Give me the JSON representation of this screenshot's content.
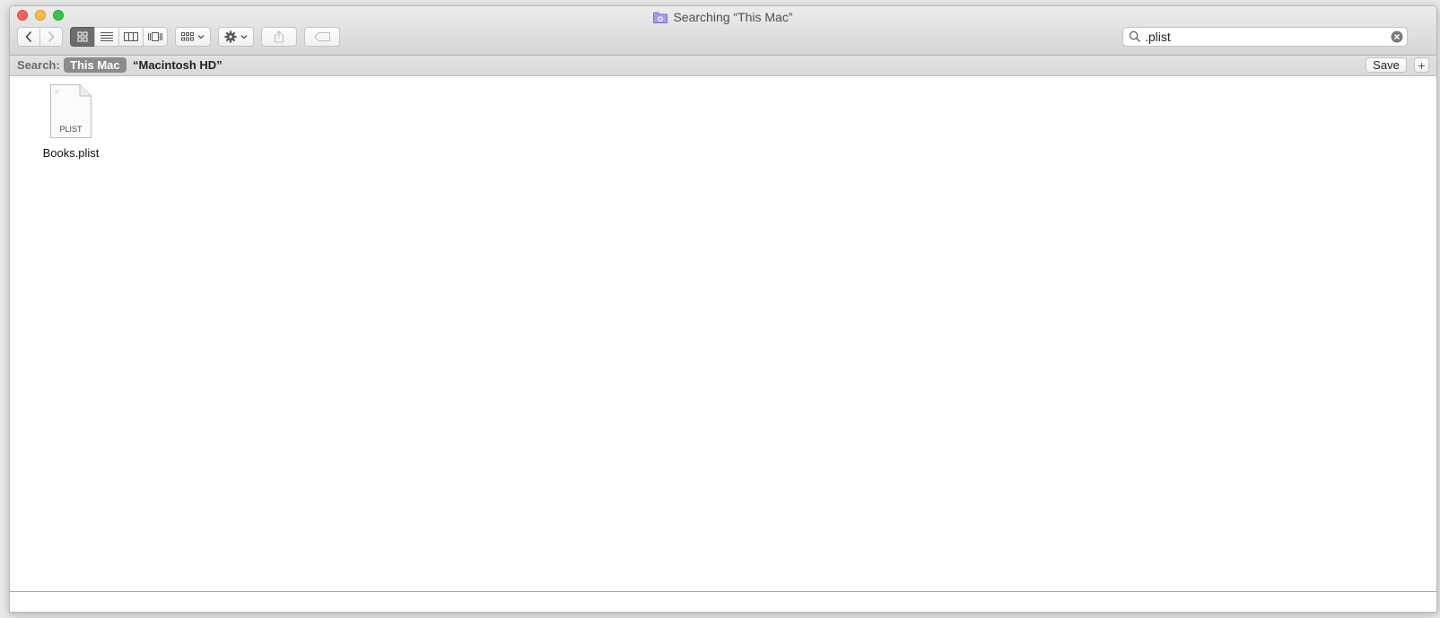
{
  "window": {
    "title": "Searching “This Mac”"
  },
  "toolbar": {
    "back_icon": "chevron-left-icon",
    "forward_icon": "chevron-right-icon",
    "view_modes": [
      "icon-view-icon",
      "list-view-icon",
      "column-view-icon",
      "cover-flow-icon"
    ],
    "active_view": "icon",
    "arrange_icon": "arrange-grid-icon",
    "action_icon": "gear-icon",
    "share_icon": "share-icon",
    "tag_icon": "tag-icon"
  },
  "search": {
    "value": ".plist"
  },
  "scope_bar": {
    "label": "Search:",
    "this_mac": "This Mac",
    "macintosh_hd": "“Macintosh HD”",
    "save_label": "Save",
    "add_label": "+"
  },
  "files": [
    {
      "name": "Books.plist",
      "type_label": "PLIST"
    }
  ],
  "colors": {
    "close": "#fc605c",
    "minimize": "#fdbc40",
    "maximize": "#34c84a",
    "active_scope": "#8b8b8b"
  }
}
